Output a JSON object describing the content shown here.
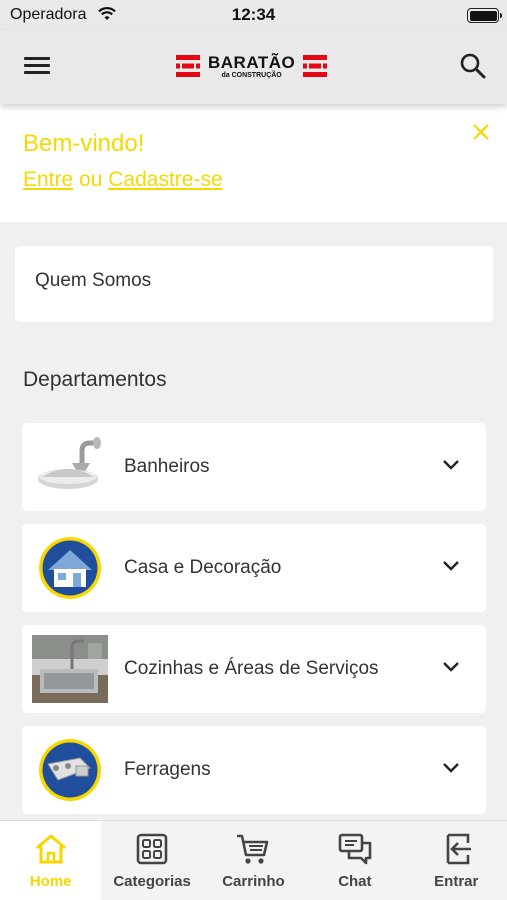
{
  "status_bar": {
    "carrier": "Operadora",
    "time": "12:34"
  },
  "header": {
    "logo_name": "BARATÃO",
    "logo_sub": "da CONSTRUÇÃO"
  },
  "welcome": {
    "title": "Bem-vindo!",
    "login_link": "Entre",
    "connector": "ou",
    "signup_link": "Cadastre-se"
  },
  "about": {
    "label": "Quem Somos"
  },
  "departments": {
    "title": "Departamentos",
    "items": [
      {
        "label": "Banheiros",
        "icon": "shower-head"
      },
      {
        "label": "Casa e Decoração",
        "icon": "house"
      },
      {
        "label": "Cozinhas e Áreas de Serviços",
        "icon": "kitchen-sink"
      },
      {
        "label": "Ferragens",
        "icon": "hinge"
      }
    ]
  },
  "tabbar": {
    "items": [
      {
        "label": "Home",
        "icon": "home-icon",
        "active": true
      },
      {
        "label": "Categorias",
        "icon": "grid-icon"
      },
      {
        "label": "Carrinho",
        "icon": "cart-icon"
      },
      {
        "label": "Chat",
        "icon": "chat-icon"
      },
      {
        "label": "Entrar",
        "icon": "login-icon"
      }
    ]
  },
  "colors": {
    "accent": "#f6d800",
    "brand_red": "#e30613",
    "background": "#f0f0f0"
  }
}
